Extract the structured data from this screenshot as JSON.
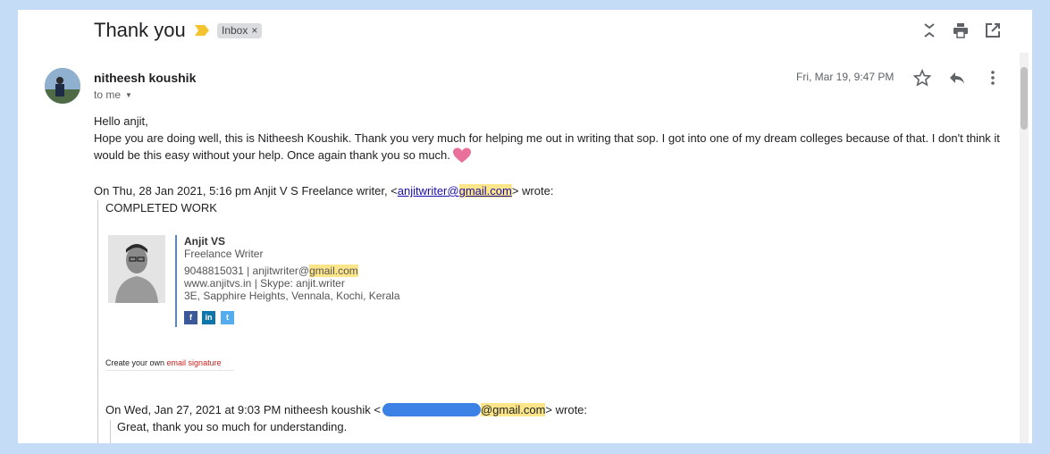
{
  "thread": {
    "subject": "Thank you",
    "label_chip": "Inbox",
    "label_remove": "×"
  },
  "toolbar": {
    "collapse_icon": "expand-collapse-icon",
    "print_icon": "print-icon",
    "popout_icon": "open-new-window-icon"
  },
  "message": {
    "sender_name": "nitheesh koushik",
    "recipient_label": "to me",
    "date": "Fri, Mar 19, 9:47 PM",
    "greeting": "Hello anjit,",
    "body": "Hope you are doing well, this is Nitheesh Koushik. Thank you very much for helping me out in writing that sop. I got into one of my dream colleges because of that. I don't think it would be this easy without your help. Once again thank you so much.",
    "emoji": "pink-heart"
  },
  "quote1": {
    "prefix": "On Thu, 28 Jan 2021, 5:16 pm Anjit V S Freelance writer, <",
    "email_user": "anjitwriter",
    "email_at": "@",
    "email_domain": "gmail.com",
    "suffix": "> wrote:",
    "text": "COMPLETED WORK"
  },
  "signature": {
    "name": "Anjit VS",
    "title": "Freelance Writer",
    "phone_email_prefix": "9048815031 | anjitwriter@",
    "phone_email_domain": "gmail.com",
    "web_skype": "www.anjitvs.in | Skype: anjit.writer",
    "address": "3E, Sapphire Heights, Vennala, Kochi, Kerala",
    "socials": [
      "f",
      "in",
      "t"
    ],
    "social_colors": [
      "#3b5998",
      "#0e76a8",
      "#55acee"
    ],
    "create_prefix": "Create your own ",
    "create_link": "email signature"
  },
  "quote2": {
    "prefix": "On Wed, Jan 27, 2021 at 9:03 PM nitheesh koushik <",
    "email_domain": "@gmail.com",
    "suffix": "> wrote:",
    "text": "Great, thank you so much for understanding."
  },
  "colors": {
    "background": "#c5dcf7",
    "highlight": "#fde68a",
    "link": "#1a0dab",
    "redaction": "#3c82e6"
  }
}
